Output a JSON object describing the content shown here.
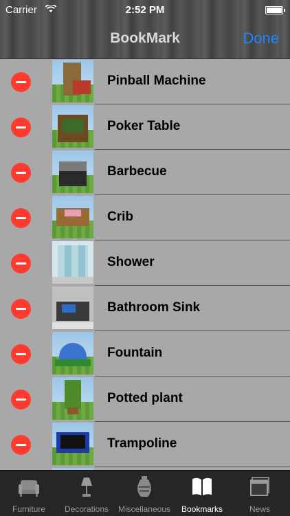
{
  "status": {
    "carrier": "Carrier",
    "time": "2:52 PM"
  },
  "nav": {
    "title": "BookMark",
    "done_label": "Done"
  },
  "items": [
    {
      "label": "Pinball Machine",
      "thumb": "pinball"
    },
    {
      "label": "Poker Table",
      "thumb": "poker"
    },
    {
      "label": "Barbecue",
      "thumb": "barbecue"
    },
    {
      "label": "Crib",
      "thumb": "crib"
    },
    {
      "label": "Shower",
      "thumb": "shower"
    },
    {
      "label": "Bathroom Sink",
      "thumb": "sink"
    },
    {
      "label": "Fountain",
      "thumb": "fountain"
    },
    {
      "label": "Potted plant",
      "thumb": "plant"
    },
    {
      "label": "Trampoline",
      "thumb": "trampoline"
    }
  ],
  "tabs": [
    {
      "label": "Furniture",
      "icon": "armchair-icon",
      "active": false
    },
    {
      "label": "Decorations",
      "icon": "lamp-icon",
      "active": false
    },
    {
      "label": "Miscellaneous",
      "icon": "vase-icon",
      "active": false
    },
    {
      "label": "Bookmarks",
      "icon": "book-icon",
      "active": true
    },
    {
      "label": "News",
      "icon": "news-icon",
      "active": false
    }
  ],
  "colors": {
    "accent": "#1e86ff",
    "delete": "#ff3b30",
    "list_bg": "#a8a8a8",
    "tabbar_bg": "#262626"
  }
}
